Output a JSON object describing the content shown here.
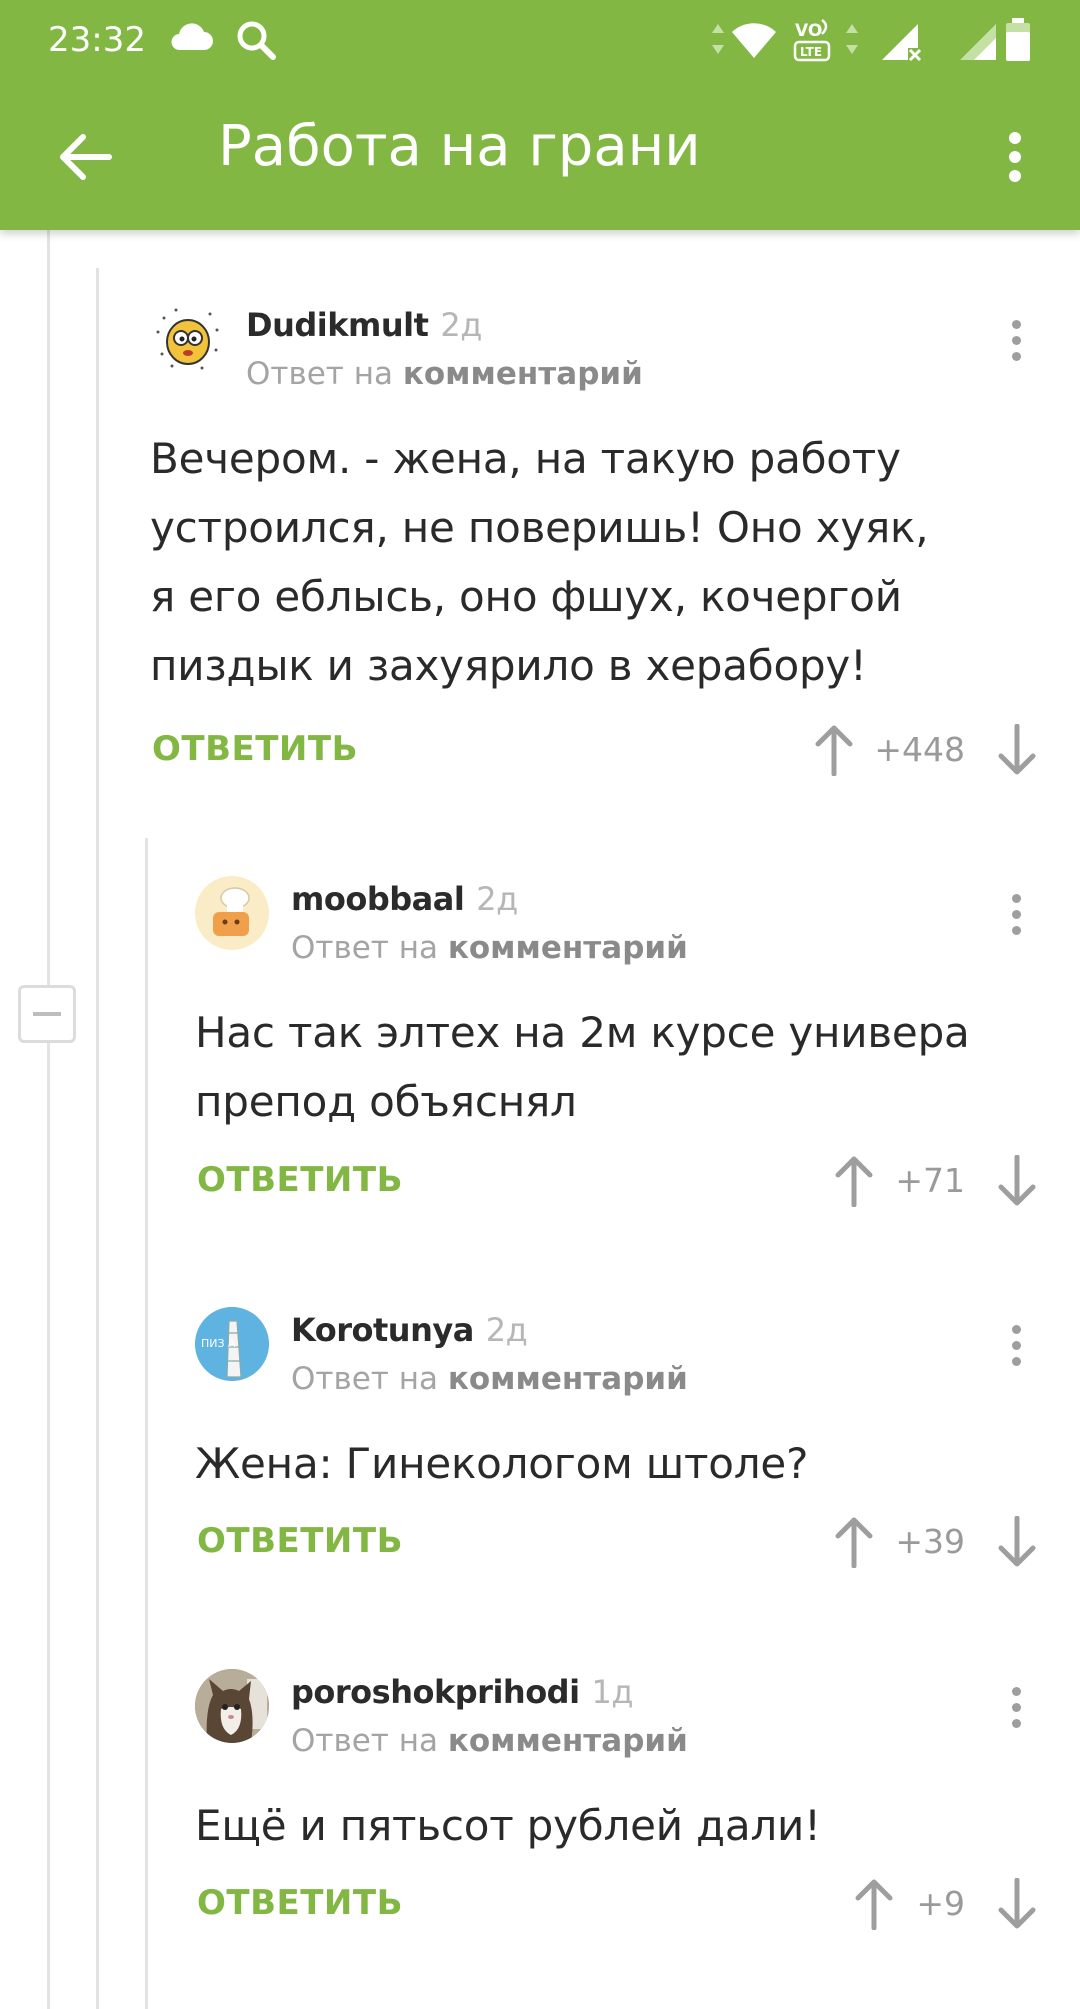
{
  "status_bar": {
    "time": "23:32",
    "network_label": "LTE"
  },
  "toolbar": {
    "title": "Работа на грани"
  },
  "comments": [
    {
      "author": "Dudikmult",
      "age": "2д",
      "reply_prefix": "Ответ на",
      "reply_target": "комментарий",
      "text": "Вечером. - жена, на такую работу\nустроился, не поверишь! Оно хуяк,\nя его еблысь, оно фшух, кочергой\nпиздык и захуярило в херабору!",
      "reply_label": "ОТВЕТИТЬ",
      "score": "+448"
    },
    {
      "author": "moobbaal",
      "age": "2д",
      "reply_prefix": "Ответ на",
      "reply_target": "комментарий",
      "text": "Нас так элтех на 2м курсе универа\nпрепод объяснял",
      "reply_label": "ОТВЕТИТЬ",
      "score": "+71"
    },
    {
      "author": "Korotunya",
      "age": "2д",
      "reply_prefix": "Ответ на",
      "reply_target": "комментарий",
      "text": "Жена: Гинекологом штоле?",
      "reply_label": "ОТВЕТИТЬ",
      "score": "+39",
      "avatar_text": "ПИЗ   А"
    },
    {
      "author": "poroshokprihodi",
      "age": "1д",
      "reply_prefix": "Ответ на",
      "reply_target": "комментарий",
      "text": "Ещё и пятьсот рублей дали!",
      "reply_label": "ОТВЕТИТЬ",
      "score": "+9"
    }
  ],
  "colors": {
    "brand_green": "#82b744",
    "text_dark": "#2a2a2a",
    "text_muted": "#a4a4a4"
  }
}
